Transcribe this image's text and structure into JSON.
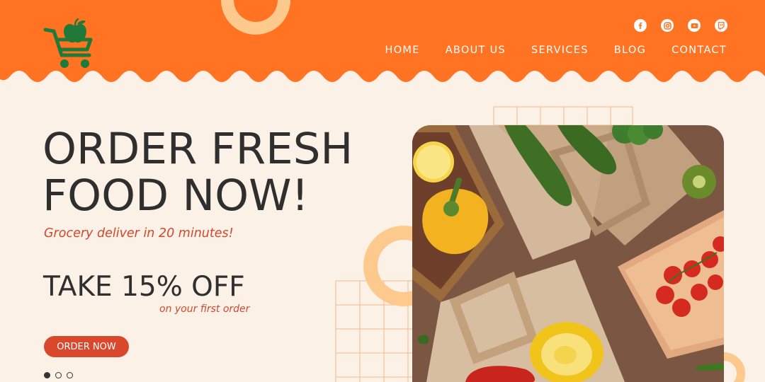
{
  "nav": {
    "items": [
      {
        "label": "HOME"
      },
      {
        "label": "ABOUT US"
      },
      {
        "label": "SERVICES"
      },
      {
        "label": "BLOG"
      },
      {
        "label": "CONTACT"
      }
    ]
  },
  "social": [
    "facebook-icon",
    "instagram-icon",
    "youtube-icon",
    "twitch-icon"
  ],
  "hero": {
    "headline_line1": "ORDER FRESH",
    "headline_line2": "FOOD NOW!",
    "subheadline": "Grocery deliver in 20 minutes!",
    "offer": "TAKE 15% OFF",
    "offer_note": "on your first order",
    "cta_label": "ORDER NOW"
  },
  "slider": {
    "count": 3,
    "active": 1
  },
  "colors": {
    "brand_orange": "#ff7322",
    "background": "#fbf1e6",
    "accent_red": "#d9472c",
    "logo_green": "#1f7a3a",
    "deco_peach": "#fdc98d"
  }
}
